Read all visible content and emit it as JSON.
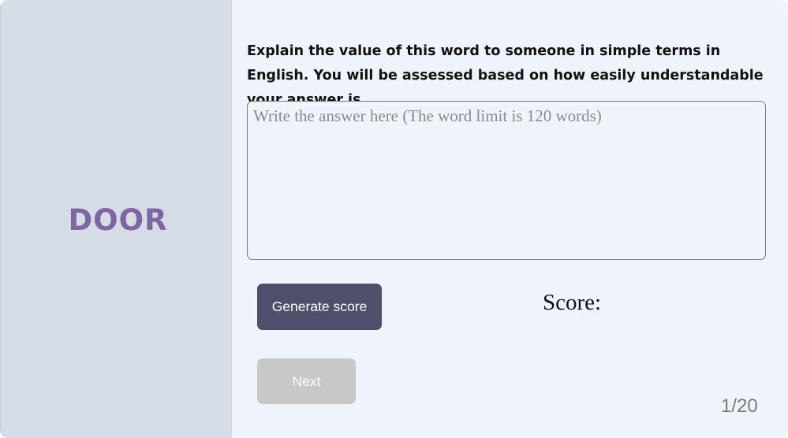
{
  "word": "DOOR",
  "prompt": "Explain the value of this word to someone in simple terms in English. You will be assessed based on how easily understandable your answer is",
  "answer": {
    "value": "",
    "placeholder": "Write the answer here (The word limit is 120 words)"
  },
  "actions": {
    "generate_label": "Generate score",
    "next_label": "Next"
  },
  "score": {
    "label": "Score:",
    "value": ""
  },
  "progress": "1/20",
  "colors": {
    "left_panel_bg": "#d6dce6",
    "right_panel_bg": "#eff4fc",
    "word_color": "#7e66a0",
    "generate_button_bg": "#4d4f6b",
    "next_button_bg_disabled": "#c8c8c8"
  }
}
